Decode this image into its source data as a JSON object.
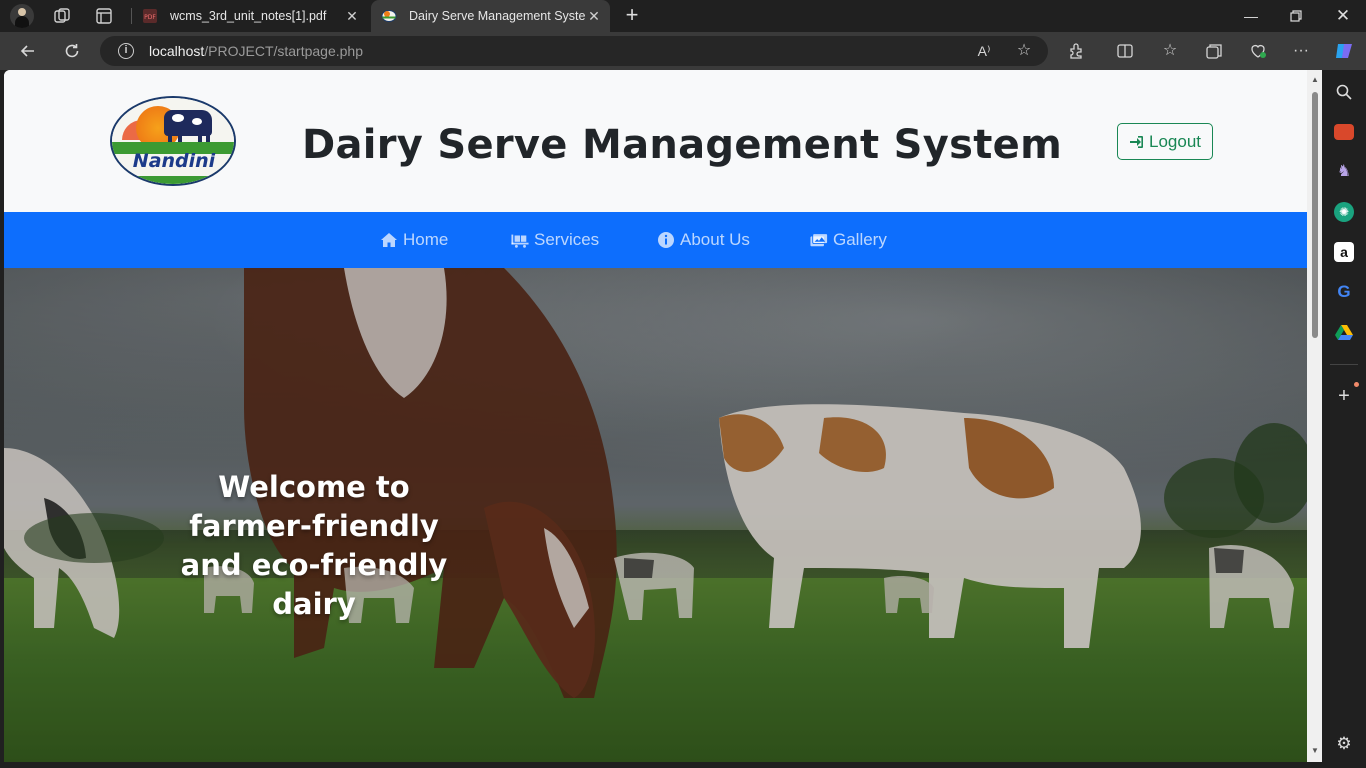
{
  "browser": {
    "tabs": [
      {
        "title": "wcms_3rd_unit_notes[1].pdf",
        "favicon": "pdf-icon",
        "active": false
      },
      {
        "title": "Dairy Serve Management System",
        "favicon": "site-favicon",
        "active": true
      }
    ],
    "url": {
      "host": "localhost",
      "path": "/PROJECT/startpage.php"
    },
    "read_aloud_label": "A⁾",
    "sidebar_icons": [
      "search-icon",
      "toolbox-icon",
      "chess-icon",
      "chatgpt-icon",
      "amazon-icon",
      "google-icon",
      "drive-icon",
      "add-icon",
      "settings-icon"
    ]
  },
  "page": {
    "title": "Dairy Serve Management System",
    "logo_text": "Nandini",
    "logout_label": "Logout",
    "nav": [
      {
        "label": "Home",
        "icon": "home-icon"
      },
      {
        "label": "Services",
        "icon": "truck-icon"
      },
      {
        "label": "About Us",
        "icon": "info-icon"
      },
      {
        "label": "Gallery",
        "icon": "gallery-icon"
      }
    ],
    "hero_text": "Welcome to farmer-friendly and eco-friendly dairy"
  },
  "colors": {
    "navbar": "#0d6efd",
    "logout": "#198754",
    "title": "#212529"
  }
}
